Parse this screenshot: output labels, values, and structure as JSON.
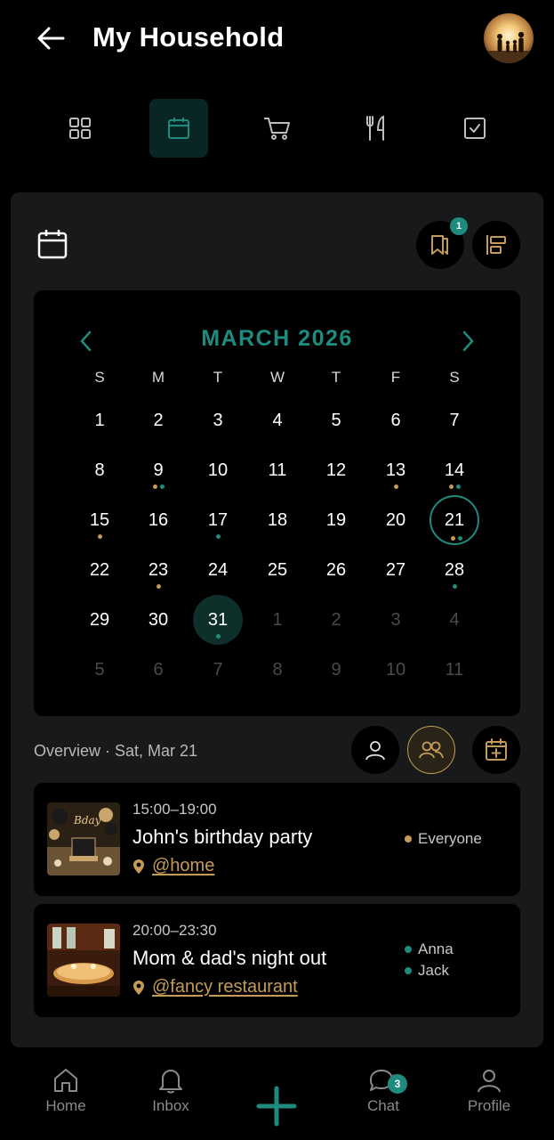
{
  "header": {
    "title": "My Household",
    "back_icon": "arrow-left-icon",
    "avatar": "family-avatar"
  },
  "tabs": [
    {
      "id": "dashboard",
      "icon": "grid-icon",
      "active": false
    },
    {
      "id": "calendar",
      "icon": "calendar-icon",
      "active": true
    },
    {
      "id": "shopping",
      "icon": "cart-icon",
      "active": false
    },
    {
      "id": "meals",
      "icon": "fork-knife-icon",
      "active": false
    },
    {
      "id": "tasks",
      "icon": "checkbox-icon",
      "active": false
    }
  ],
  "card": {
    "bookmark_badge": "1"
  },
  "calendar": {
    "month_label": "MARCH 2026",
    "weekdays": [
      "S",
      "M",
      "T",
      "W",
      "T",
      "F",
      "S"
    ],
    "weeks": [
      [
        "1",
        "2",
        "3",
        "4",
        "5",
        "6",
        "7"
      ],
      [
        "8",
        "9",
        "10",
        "11",
        "12",
        "13",
        "14"
      ],
      [
        "15",
        "16",
        "17",
        "18",
        "19",
        "20",
        "21"
      ],
      [
        "22",
        "23",
        "24",
        "25",
        "26",
        "27",
        "28"
      ],
      [
        "29",
        "30",
        "31",
        "1",
        "2",
        "3",
        "4"
      ],
      [
        "5",
        "6",
        "7",
        "8",
        "9",
        "10",
        "11"
      ]
    ],
    "selected_day": "21",
    "today_day": "31",
    "colors": {
      "accent": "#1f8a7e",
      "gold": "#c49b57"
    }
  },
  "overview": {
    "label": "Overview · Sat, Mar 21"
  },
  "events": [
    {
      "time": "15:00–19:00",
      "title": "John's birthday party",
      "location": "@home",
      "attendees": [
        {
          "name": "Everyone",
          "color": "gold"
        }
      ]
    },
    {
      "time": "20:00–23:30",
      "title": "Mom & dad's night out",
      "location": "@fancy restaurant",
      "attendees": [
        {
          "name": "Anna",
          "color": "teal"
        },
        {
          "name": "Jack",
          "color": "teal"
        }
      ]
    }
  ],
  "bottom_nav": {
    "items": [
      {
        "label": "Home",
        "icon": "home-icon"
      },
      {
        "label": "Inbox",
        "icon": "bell-icon"
      },
      {
        "label": "",
        "icon": "plus-icon"
      },
      {
        "label": "Chat",
        "icon": "chat-icon",
        "badge": "3"
      },
      {
        "label": "Profile",
        "icon": "user-icon"
      }
    ]
  }
}
